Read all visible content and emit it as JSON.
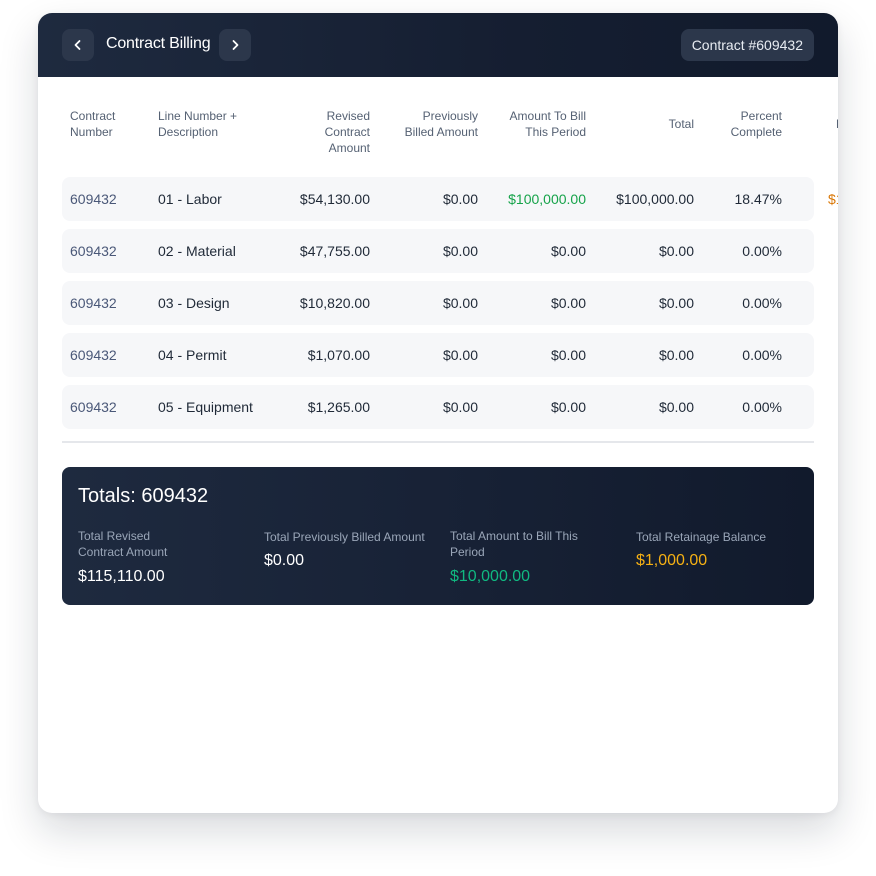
{
  "header": {
    "title": "Contract Billing",
    "contract_badge": "Contract #609432"
  },
  "table": {
    "columns": [
      "Contract\nNumber",
      "Line Number +\nDescription",
      "Revised\nContract\nAmount",
      "Previously\nBilled Amount",
      "Amount To Bill\nThis Period",
      "Total",
      "Percent\nComplete",
      "R"
    ],
    "rows": [
      [
        "609432",
        "01 - Labor",
        "$54,130.00",
        "$0.00",
        "$100,000.00",
        "$100,000.00",
        "18.47%",
        "$1"
      ],
      [
        "609432",
        "02 - Material",
        "$47,755.00",
        "$0.00",
        "$0.00",
        "$0.00",
        "0.00%",
        ""
      ],
      [
        "609432",
        "03 - Design",
        "$10,820.00",
        "$0.00",
        "$0.00",
        "$0.00",
        "0.00%",
        ""
      ],
      [
        "609432",
        "04 - Permit",
        "$1,070.00",
        "$0.00",
        "$0.00",
        "$0.00",
        "0.00%",
        ""
      ],
      [
        "609432",
        "05 - Equipment",
        "$1,265.00",
        "$0.00",
        "$0.00",
        "$0.00",
        "0.00%",
        ""
      ]
    ]
  },
  "totals": {
    "title": "Totals: 609432",
    "items": [
      {
        "label": "Total Revised\nContract Amount",
        "value": "$115,110.00"
      },
      {
        "label": "Total Previously Billed Amount",
        "value": "$0.00"
      },
      {
        "label": "Total Amount to Bill This\nPeriod",
        "value": "$10,000.00"
      },
      {
        "label": "Total Retainage Balance",
        "value": "$1,000.00"
      }
    ]
  },
  "colors": {
    "header_bg": "#1e2a3f",
    "row_bg": "#f6f7f9",
    "positive_amount": "#16a34a",
    "retainage_amount": "#d97706",
    "totals_green": "#10b981",
    "totals_amber": "#f5b014"
  },
  "icons": {
    "prev": "chevron-left-icon",
    "next": "chevron-right-icon"
  }
}
